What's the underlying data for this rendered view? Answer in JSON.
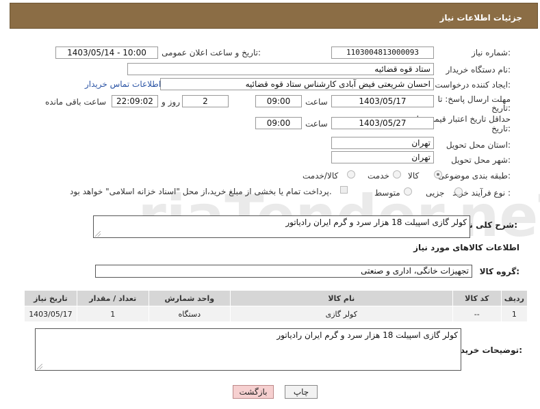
{
  "header": {
    "title": "جزئیات اطلاعات نیاز"
  },
  "watermark_text": "AriaTender.neT",
  "form": {
    "need_number": {
      "label": "شماره نیاز:",
      "value": "1103004813000093"
    },
    "announce_datetime": {
      "label": "تاریخ و ساعت اعلان عمومی:",
      "value": "1403/05/14 - 10:00"
    },
    "buyer_org": {
      "label": "نام دستگاه خریدار:",
      "value": "ستاد قوه قضائیه"
    },
    "requester": {
      "label": "ایجاد کننده درخواست:",
      "value": "احسان شریعتی فیض آبادی کارشناس ستاد قوه قضائیه",
      "contact_link": "اطلاعات تماس خریدار"
    },
    "reply_deadline": {
      "label_line1": "مهلت ارسال پاسخ: تا",
      "label_line2": "تاریخ:",
      "date": "1403/05/17",
      "time_label": "ساعت",
      "time": "09:00",
      "days": "2",
      "days_label": "روز و",
      "remaining": "22:09:02",
      "remaining_label": "ساعت باقی مانده"
    },
    "price_validity": {
      "label_line1": "حداقل تاریخ اعتبار قیمت: تا",
      "label_line2": "تاریخ:",
      "date": "1403/05/27",
      "time_label": "ساعت",
      "time": "09:00"
    },
    "province": {
      "label": "استان محل تحویل:",
      "value": "تهران"
    },
    "city": {
      "label": "شهر محل تحویل:",
      "value": "تهران"
    },
    "category": {
      "label": "طبقه بندی موضوعی:",
      "options": [
        "کالا",
        "خدمت",
        "کالا/خدمت"
      ],
      "selected": "کالا"
    },
    "purchase_process": {
      "label": "نوع فرآیند خرید :",
      "options": [
        "جزیی",
        "متوسط"
      ],
      "note": "پرداخت تمام یا بخشی از مبلغ خرید،از محل \"اسناد خزانه اسلامی\" خواهد بود."
    }
  },
  "description": {
    "label": "شرح کلی نیاز:",
    "value": "کولر گازی اسپیلت 18 هزار سرد و گرم ایران رادیاتور"
  },
  "goods_section": {
    "title": "اطلاعات کالاهای مورد نیاز",
    "group_label": "گروه کالا:",
    "group_value": "تجهیزات خانگی، اداری و صنعتی"
  },
  "table": {
    "headers": [
      "ردیف",
      "کد کالا",
      "نام کالا",
      "واحد شمارش",
      "تعداد / مقدار",
      "تاریخ نیاز"
    ],
    "rows": [
      [
        "1",
        "--",
        "کولر گازی",
        "دستگاه",
        "1",
        "1403/05/17"
      ]
    ]
  },
  "buyer_notes": {
    "label": "توضیحات خریدار:",
    "value": "کولر گازی اسپیلت 18 هزار سرد و گرم ایران رادیاتور"
  },
  "buttons": {
    "print": "چاپ",
    "back": "بازگشت"
  }
}
